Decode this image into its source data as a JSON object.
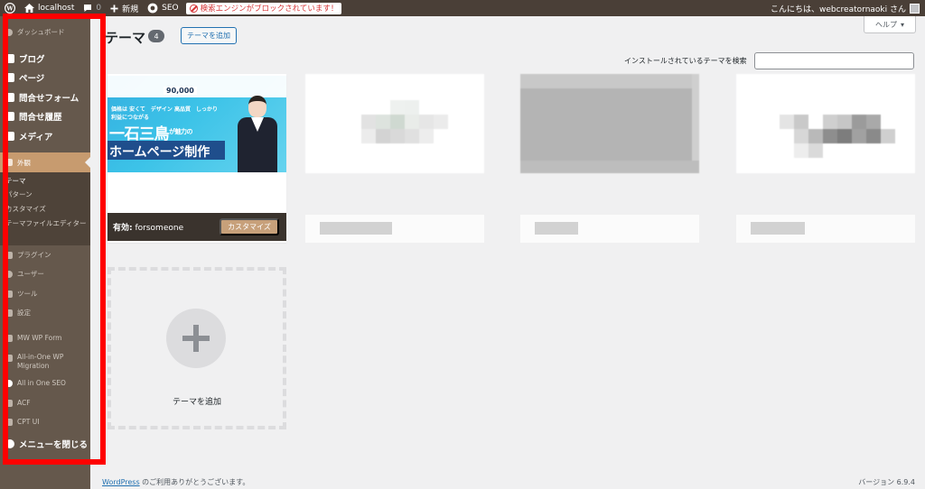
{
  "adminbar": {
    "site_name": "localhost",
    "comments_count": "0",
    "new_label": "新規",
    "seo_label": "SEO",
    "alert_label": "検索エンジンがブロックされています！",
    "greeting": "こんにちは、webcreatornaoki さん"
  },
  "sidebar": {
    "dashboard": "ダッシュボード",
    "blog": "ブログ",
    "page": "ページ",
    "contact_form": "問合せフォーム",
    "contact_history": "問合せ履歴",
    "media": "メディア",
    "appearance": "外観",
    "sub": [
      "テーマ",
      "パターン",
      "カスタマイズ",
      "テーマファイルエディター"
    ],
    "plugins": "プラグイン",
    "users": "ユーザー",
    "tools": "ツール",
    "settings": "設定",
    "mw_wp_form": "MW WP Form",
    "aio_migration": "All-in-One WP Migration",
    "aio_seo": "All in One SEO",
    "acf": "ACF",
    "cpt_ui": "CPT UI",
    "collapse": "メニューを閉じる"
  },
  "main": {
    "title": "テーマ",
    "count": "4",
    "add_new": "テーマを追加",
    "help": "ヘルプ",
    "search_label": "インストールされているテーマを検索",
    "search_value": "",
    "active_theme": {
      "prefix": "有効:",
      "name": "forsomeone",
      "customize": "カスタマイズ",
      "screenshot": {
        "stat": "90,000",
        "features": "価格は 安くて　デザイン 高品質　しっかり 利益につながる",
        "headline": "一石三鳥",
        "headline_small": "が魅力の",
        "subhead": "ホームページ制作"
      }
    },
    "add_tile_label": "テーマを追加"
  },
  "footer": {
    "wp_link": "WordPress",
    "thanks": " のご利用ありがとうございます。",
    "version": "バージョン 6.9.4"
  },
  "colors": {
    "sidebar": "#65584c",
    "accent": "#c79b6f",
    "admin_bar": "#4a3f37",
    "highlight_frame": "#ff0000"
  }
}
